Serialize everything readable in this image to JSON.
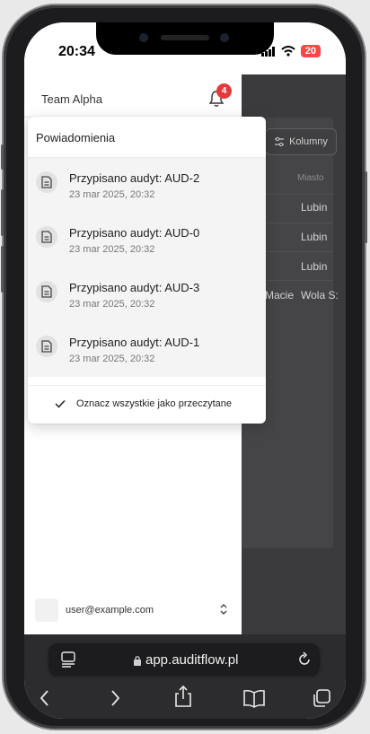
{
  "status": {
    "time": "20:34",
    "battery": "20"
  },
  "drawer": {
    "team_name": "Team Alpha",
    "notification_count": "4",
    "user_email": "user@example.com"
  },
  "notifications": {
    "title": "Powiadomienia",
    "items": [
      {
        "title": "Przypisano audyt: AUD-2",
        "date": "23 mar 2025, 20:32"
      },
      {
        "title": "Przypisano audyt: AUD-0",
        "date": "23 mar 2025, 20:32"
      },
      {
        "title": "Przypisano audyt: AUD-3",
        "date": "23 mar 2025, 20:32"
      },
      {
        "title": "Przypisano audyt: AUD-1",
        "date": "23 mar 2025, 20:32"
      }
    ],
    "mark_all_label": "Oznacz wszystkie jako przeczytane"
  },
  "background": {
    "columns_button": "Kolumny",
    "city_header": "Miasto",
    "rows": [
      {
        "name": "",
        "city": "Lubin"
      },
      {
        "name": "",
        "city": "Lubin"
      },
      {
        "name": "",
        "city": "Lubin"
      },
      {
        "name": "Macie",
        "city": "Wola S:"
      }
    ]
  },
  "browser": {
    "url": "app.auditflow.pl"
  },
  "icons": [
    "bell-icon",
    "document-icon",
    "check-icon",
    "chevron-updown-icon",
    "lock-icon",
    "reload-icon",
    "tabs-list-icon",
    "back-icon",
    "forward-icon",
    "share-icon",
    "bookmarks-icon",
    "tabs-icon",
    "wifi-icon",
    "signal-icon",
    "sliders-icon"
  ]
}
